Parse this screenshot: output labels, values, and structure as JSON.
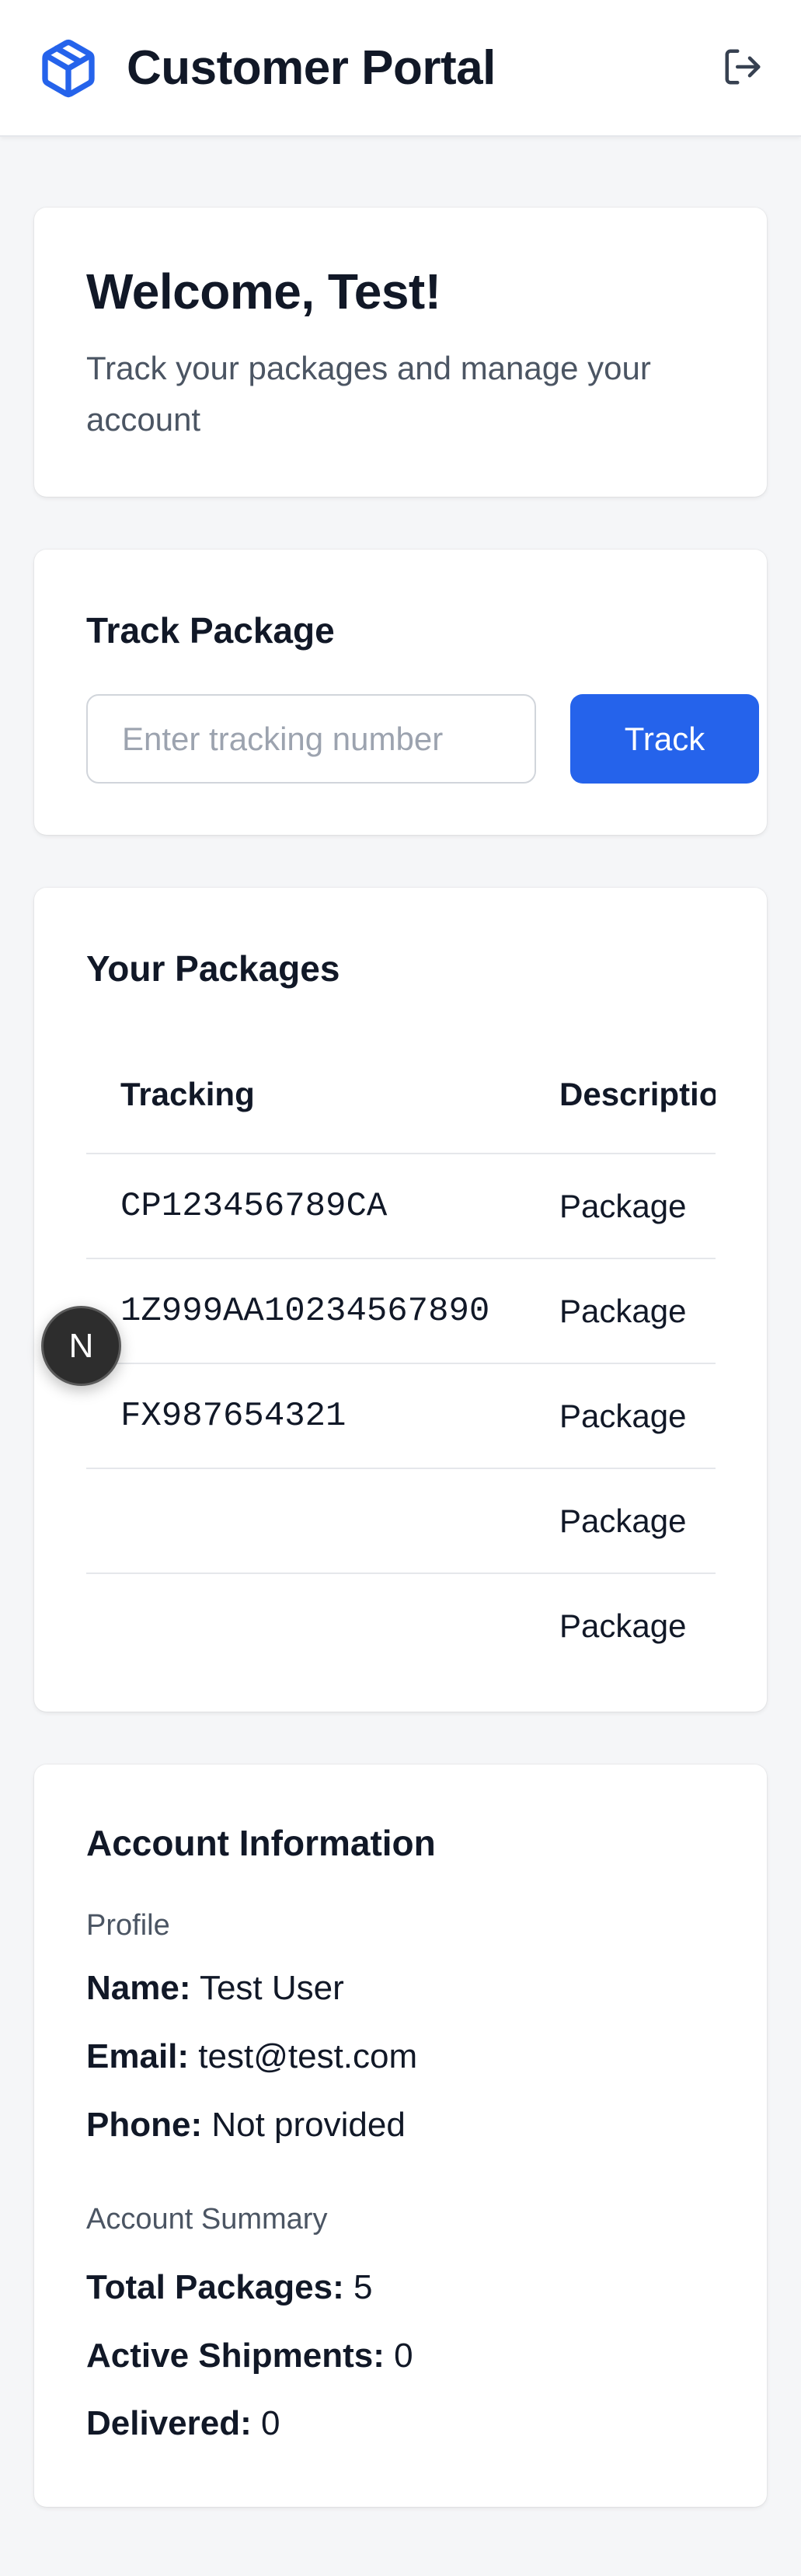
{
  "header": {
    "title": "Customer Portal",
    "logo_icon": "package-cube-icon",
    "logout_icon": "logout-icon",
    "accent_color": "#2563eb"
  },
  "welcome": {
    "title": "Welcome, Test!",
    "subtitle": "Track your packages and manage your account"
  },
  "track": {
    "title": "Track Package",
    "input_placeholder": "Enter tracking number",
    "input_value": "",
    "button_label": "Track"
  },
  "packages": {
    "title": "Your Packages",
    "columns": [
      "Tracking",
      "Description"
    ],
    "rows": [
      {
        "tracking": "CP123456789CA",
        "description": "Package"
      },
      {
        "tracking": "1Z999AA10234567890",
        "description": "Package"
      },
      {
        "tracking": "FX987654321",
        "description": "Package"
      },
      {
        "tracking": "",
        "description": "Package"
      },
      {
        "tracking": "",
        "description": "Package"
      }
    ]
  },
  "floating_badge": {
    "letter": "N"
  },
  "account": {
    "title": "Account Information",
    "profile_heading": "Profile",
    "name_label": "Name:",
    "name_value": "Test User",
    "email_label": "Email:",
    "email_value": "test@test.com",
    "phone_label": "Phone:",
    "phone_value": "Not provided",
    "summary_heading": "Account Summary",
    "total_label": "Total Packages:",
    "total_value": "5",
    "active_label": "Active Shipments:",
    "active_value": "0",
    "delivered_label": "Delivered:",
    "delivered_value": "0"
  }
}
